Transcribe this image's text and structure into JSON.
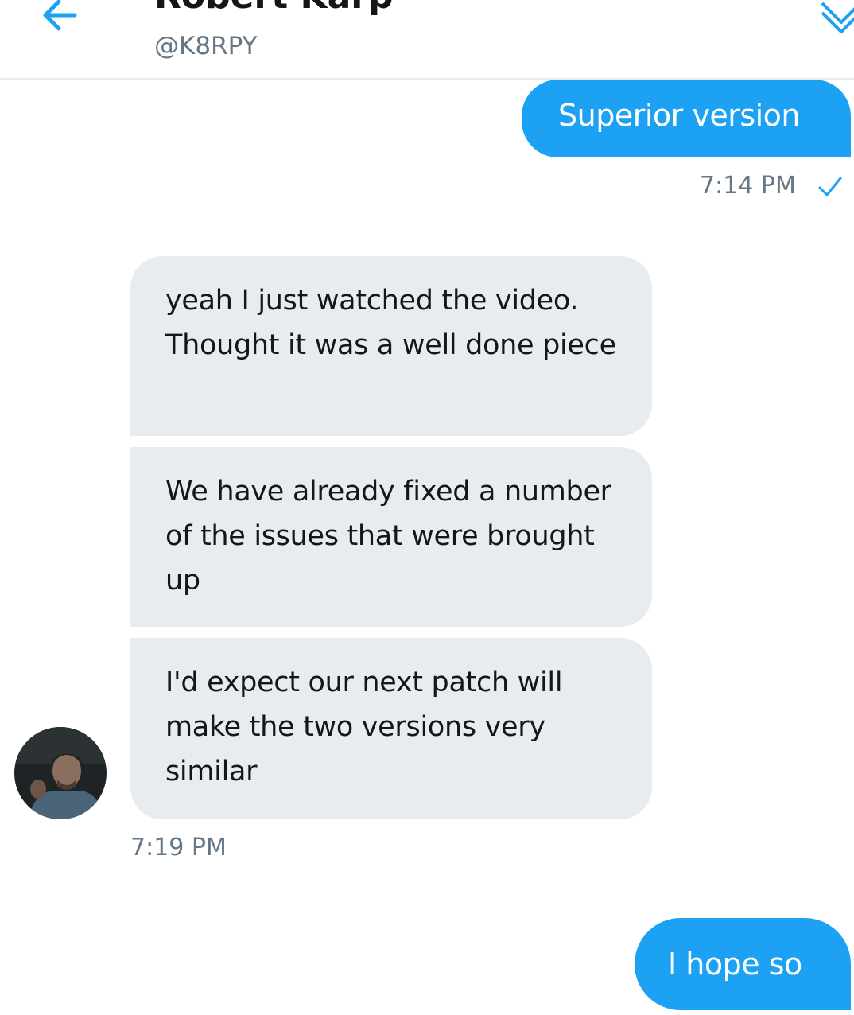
{
  "header": {
    "name": "Robert Karp",
    "handle": "@K8RPY",
    "back_icon": "arrow-left-icon",
    "menu_icon": "chevron-down-icon"
  },
  "messages": [
    {
      "sender": "me",
      "text": "Superior version",
      "time": "7:14 PM",
      "status_icon": "check-icon"
    },
    {
      "sender": "them",
      "text": "yeah I just watched the video. Thought it was a well done piece"
    },
    {
      "sender": "them",
      "text": "We have already fixed a number of the issues that were brought up"
    },
    {
      "sender": "them",
      "text": "I'd expect our next patch will make the two versions very similar",
      "time": "7:19 PM"
    },
    {
      "sender": "me",
      "text": "I hope so"
    }
  ],
  "colors": {
    "accent": "#1da1f2",
    "incoming_bubble": "#e6ecf0",
    "text_primary": "#14171a",
    "text_secondary": "#657786"
  }
}
